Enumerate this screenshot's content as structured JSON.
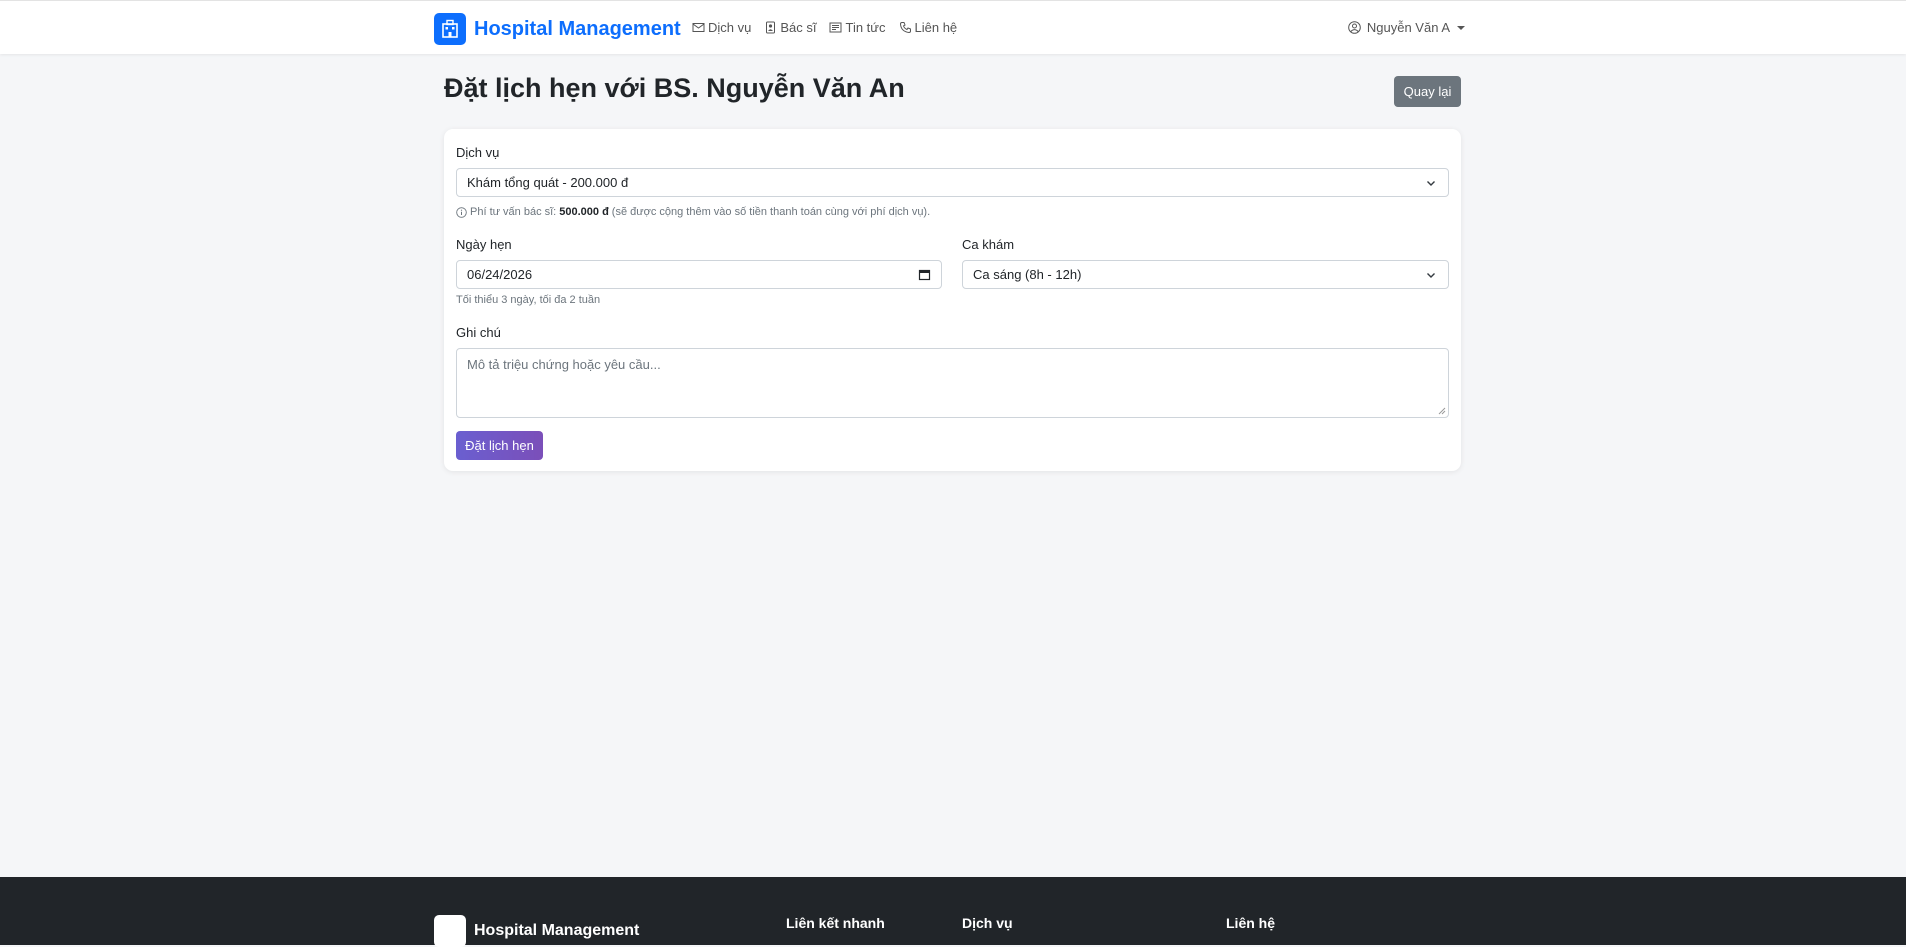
{
  "navbar": {
    "brand": "Hospital Management",
    "items": [
      {
        "label": "Dịch vụ",
        "icon": "envelope-icon"
      },
      {
        "label": "Bác sĩ",
        "icon": "doctor-badge-icon"
      },
      {
        "label": "Tin tức",
        "icon": "newspaper-icon"
      },
      {
        "label": "Liên hệ",
        "icon": "phone-icon"
      }
    ],
    "user": "Nguyễn Văn A"
  },
  "page": {
    "title": "Đặt lịch hẹn với BS. Nguyễn Văn An",
    "back_label": "Quay lại"
  },
  "form": {
    "service_label": "Dịch vụ",
    "service_value": "Khám tổng quát - 200.000 đ",
    "fee_hint_prefix": "Phí tư vấn bác sĩ:",
    "fee_amount": "500.000 đ",
    "fee_hint_suffix": "(sẽ được cộng thêm vào số tiền thanh toán cùng với phí dịch vụ).",
    "date_label": "Ngày hẹn",
    "date_value": "06/24/2026",
    "date_hint": "Tối thiểu 3 ngày, tối đa 2 tuần",
    "shift_label": "Ca khám",
    "shift_value": "Ca sáng (8h - 12h)",
    "note_label": "Ghi chú",
    "note_placeholder": "Mô tả triệu chứng hoặc yêu cầu...",
    "submit_label": "Đặt lịch hẹn"
  },
  "footer": {
    "brand": "Hospital Management",
    "col_links": "Liên kết nhanh",
    "col_services": "Dịch vụ",
    "col_contact": "Liên hệ"
  },
  "colors": {
    "primary": "#0d6efd",
    "secondary": "#6c757d",
    "submit": "#6f57c8",
    "footer": "#212529"
  }
}
